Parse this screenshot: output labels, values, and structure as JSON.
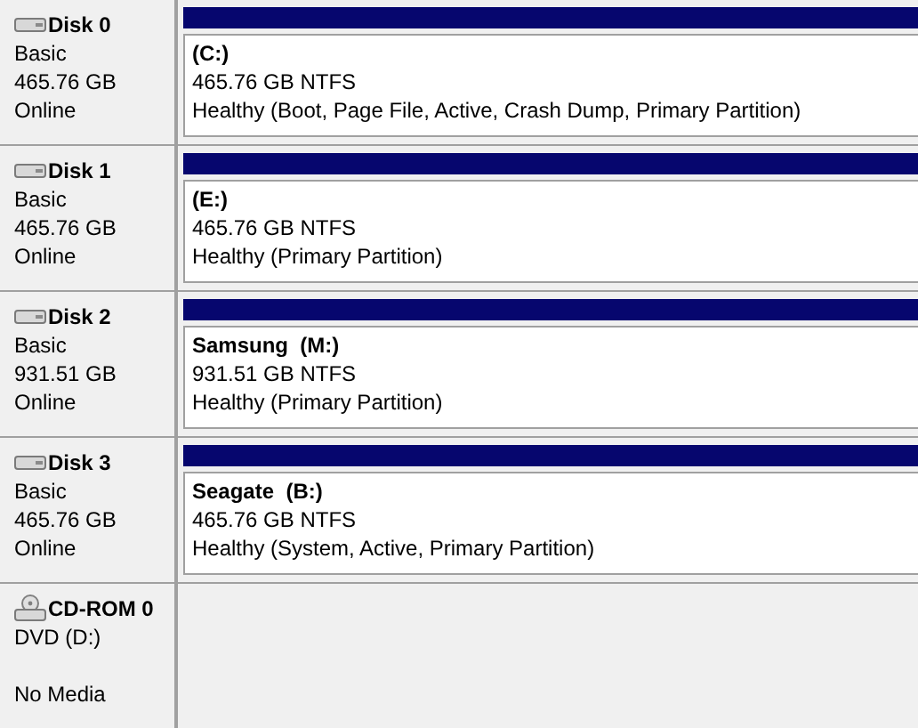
{
  "disks": [
    {
      "kind": "disk",
      "name": "Disk 0",
      "lines": [
        "Basic",
        "465.76 GB",
        "Online"
      ],
      "partition": {
        "label": "(C:)",
        "size": "465.76 GB NTFS",
        "status": "Healthy (Boot, Page File, Active, Crash Dump, Primary Partition)"
      }
    },
    {
      "kind": "disk",
      "name": "Disk 1",
      "lines": [
        "Basic",
        "465.76 GB",
        "Online"
      ],
      "partition": {
        "label": "(E:)",
        "size": "465.76 GB NTFS",
        "status": "Healthy (Primary Partition)"
      }
    },
    {
      "kind": "disk",
      "name": "Disk 2",
      "lines": [
        "Basic",
        "931.51 GB",
        "Online"
      ],
      "partition": {
        "label": "Samsung  (M:)",
        "size": "931.51 GB NTFS",
        "status": "Healthy (Primary Partition)"
      }
    },
    {
      "kind": "disk",
      "name": "Disk 3",
      "lines": [
        "Basic",
        "465.76 GB",
        "Online"
      ],
      "partition": {
        "label": "Seagate  (B:)",
        "size": "465.76 GB NTFS",
        "status": "Healthy (System, Active, Primary Partition)"
      }
    },
    {
      "kind": "cdrom",
      "name": "CD-ROM 0",
      "lines": [
        "DVD (D:)"
      ],
      "media": "No Media"
    }
  ]
}
